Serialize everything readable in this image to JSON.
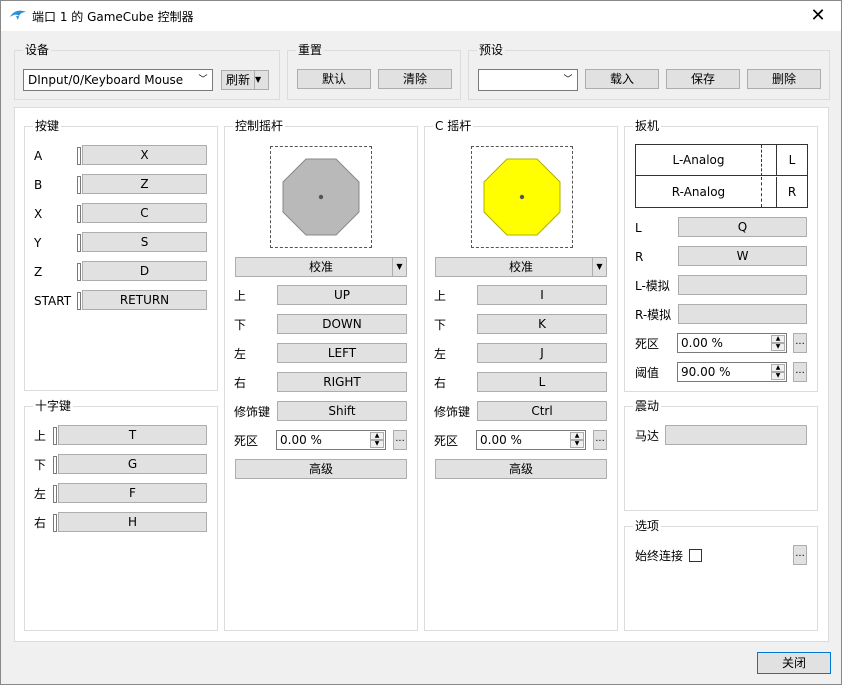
{
  "window": {
    "title": "端口 1 的 GameCube 控制器",
    "close_glyph": "✕"
  },
  "device": {
    "label": "设备",
    "value": "DInput/0/Keyboard Mouse",
    "refresh": "刷新"
  },
  "reset": {
    "label": "重置",
    "default": "默认",
    "clear": "清除"
  },
  "preset": {
    "label": "预设",
    "value": "",
    "load": "载入",
    "save": "保存",
    "delete": "删除"
  },
  "buttons": {
    "label": "按键",
    "items": [
      {
        "name": "A",
        "key": "X"
      },
      {
        "name": "B",
        "key": "Z"
      },
      {
        "name": "X",
        "key": "C"
      },
      {
        "name": "Y",
        "key": "S"
      },
      {
        "name": "Z",
        "key": "D"
      },
      {
        "name": "START",
        "key": "RETURN"
      }
    ]
  },
  "dpad": {
    "label": "十字键",
    "items": [
      {
        "name": "上",
        "key": "T"
      },
      {
        "name": "下",
        "key": "G"
      },
      {
        "name": "左",
        "key": "F"
      },
      {
        "name": "右",
        "key": "H"
      }
    ]
  },
  "main_stick": {
    "label": "控制摇杆",
    "calibrate": "校准",
    "color": "#b9b9b9",
    "items": [
      {
        "name": "上",
        "key": "UP"
      },
      {
        "name": "下",
        "key": "DOWN"
      },
      {
        "name": "左",
        "key": "LEFT"
      },
      {
        "name": "右",
        "key": "RIGHT"
      },
      {
        "name": "修饰键",
        "key": "Shift"
      }
    ],
    "deadzone_label": "死区",
    "deadzone": "0.00 %",
    "advanced": "高级"
  },
  "c_stick": {
    "label": "C 摇杆",
    "calibrate": "校准",
    "color": "#ffff00",
    "items": [
      {
        "name": "上",
        "key": "I"
      },
      {
        "name": "下",
        "key": "K"
      },
      {
        "name": "左",
        "key": "J"
      },
      {
        "name": "右",
        "key": "L"
      },
      {
        "name": "修饰键",
        "key": "Ctrl"
      }
    ],
    "deadzone_label": "死区",
    "deadzone": "0.00 %",
    "advanced": "高级"
  },
  "triggers": {
    "label": "扳机",
    "left_analog": "L-Analog",
    "left_short": "L",
    "right_analog": "R-Analog",
    "right_short": "R",
    "items": [
      {
        "name": "L",
        "key": "Q"
      },
      {
        "name": "R",
        "key": "W"
      },
      {
        "name": "L-模拟",
        "key": ""
      },
      {
        "name": "R-模拟",
        "key": ""
      }
    ],
    "deadzone_label": "死区",
    "deadzone": "0.00 %",
    "threshold_label": "阈值",
    "threshold": "90.00 %"
  },
  "rumble": {
    "label": "震动",
    "motor_label": "马达",
    "motor_key": ""
  },
  "options": {
    "label": "选项",
    "always_connected": "始终连接"
  },
  "footer": {
    "close": "关闭"
  },
  "dots_glyph": "..."
}
